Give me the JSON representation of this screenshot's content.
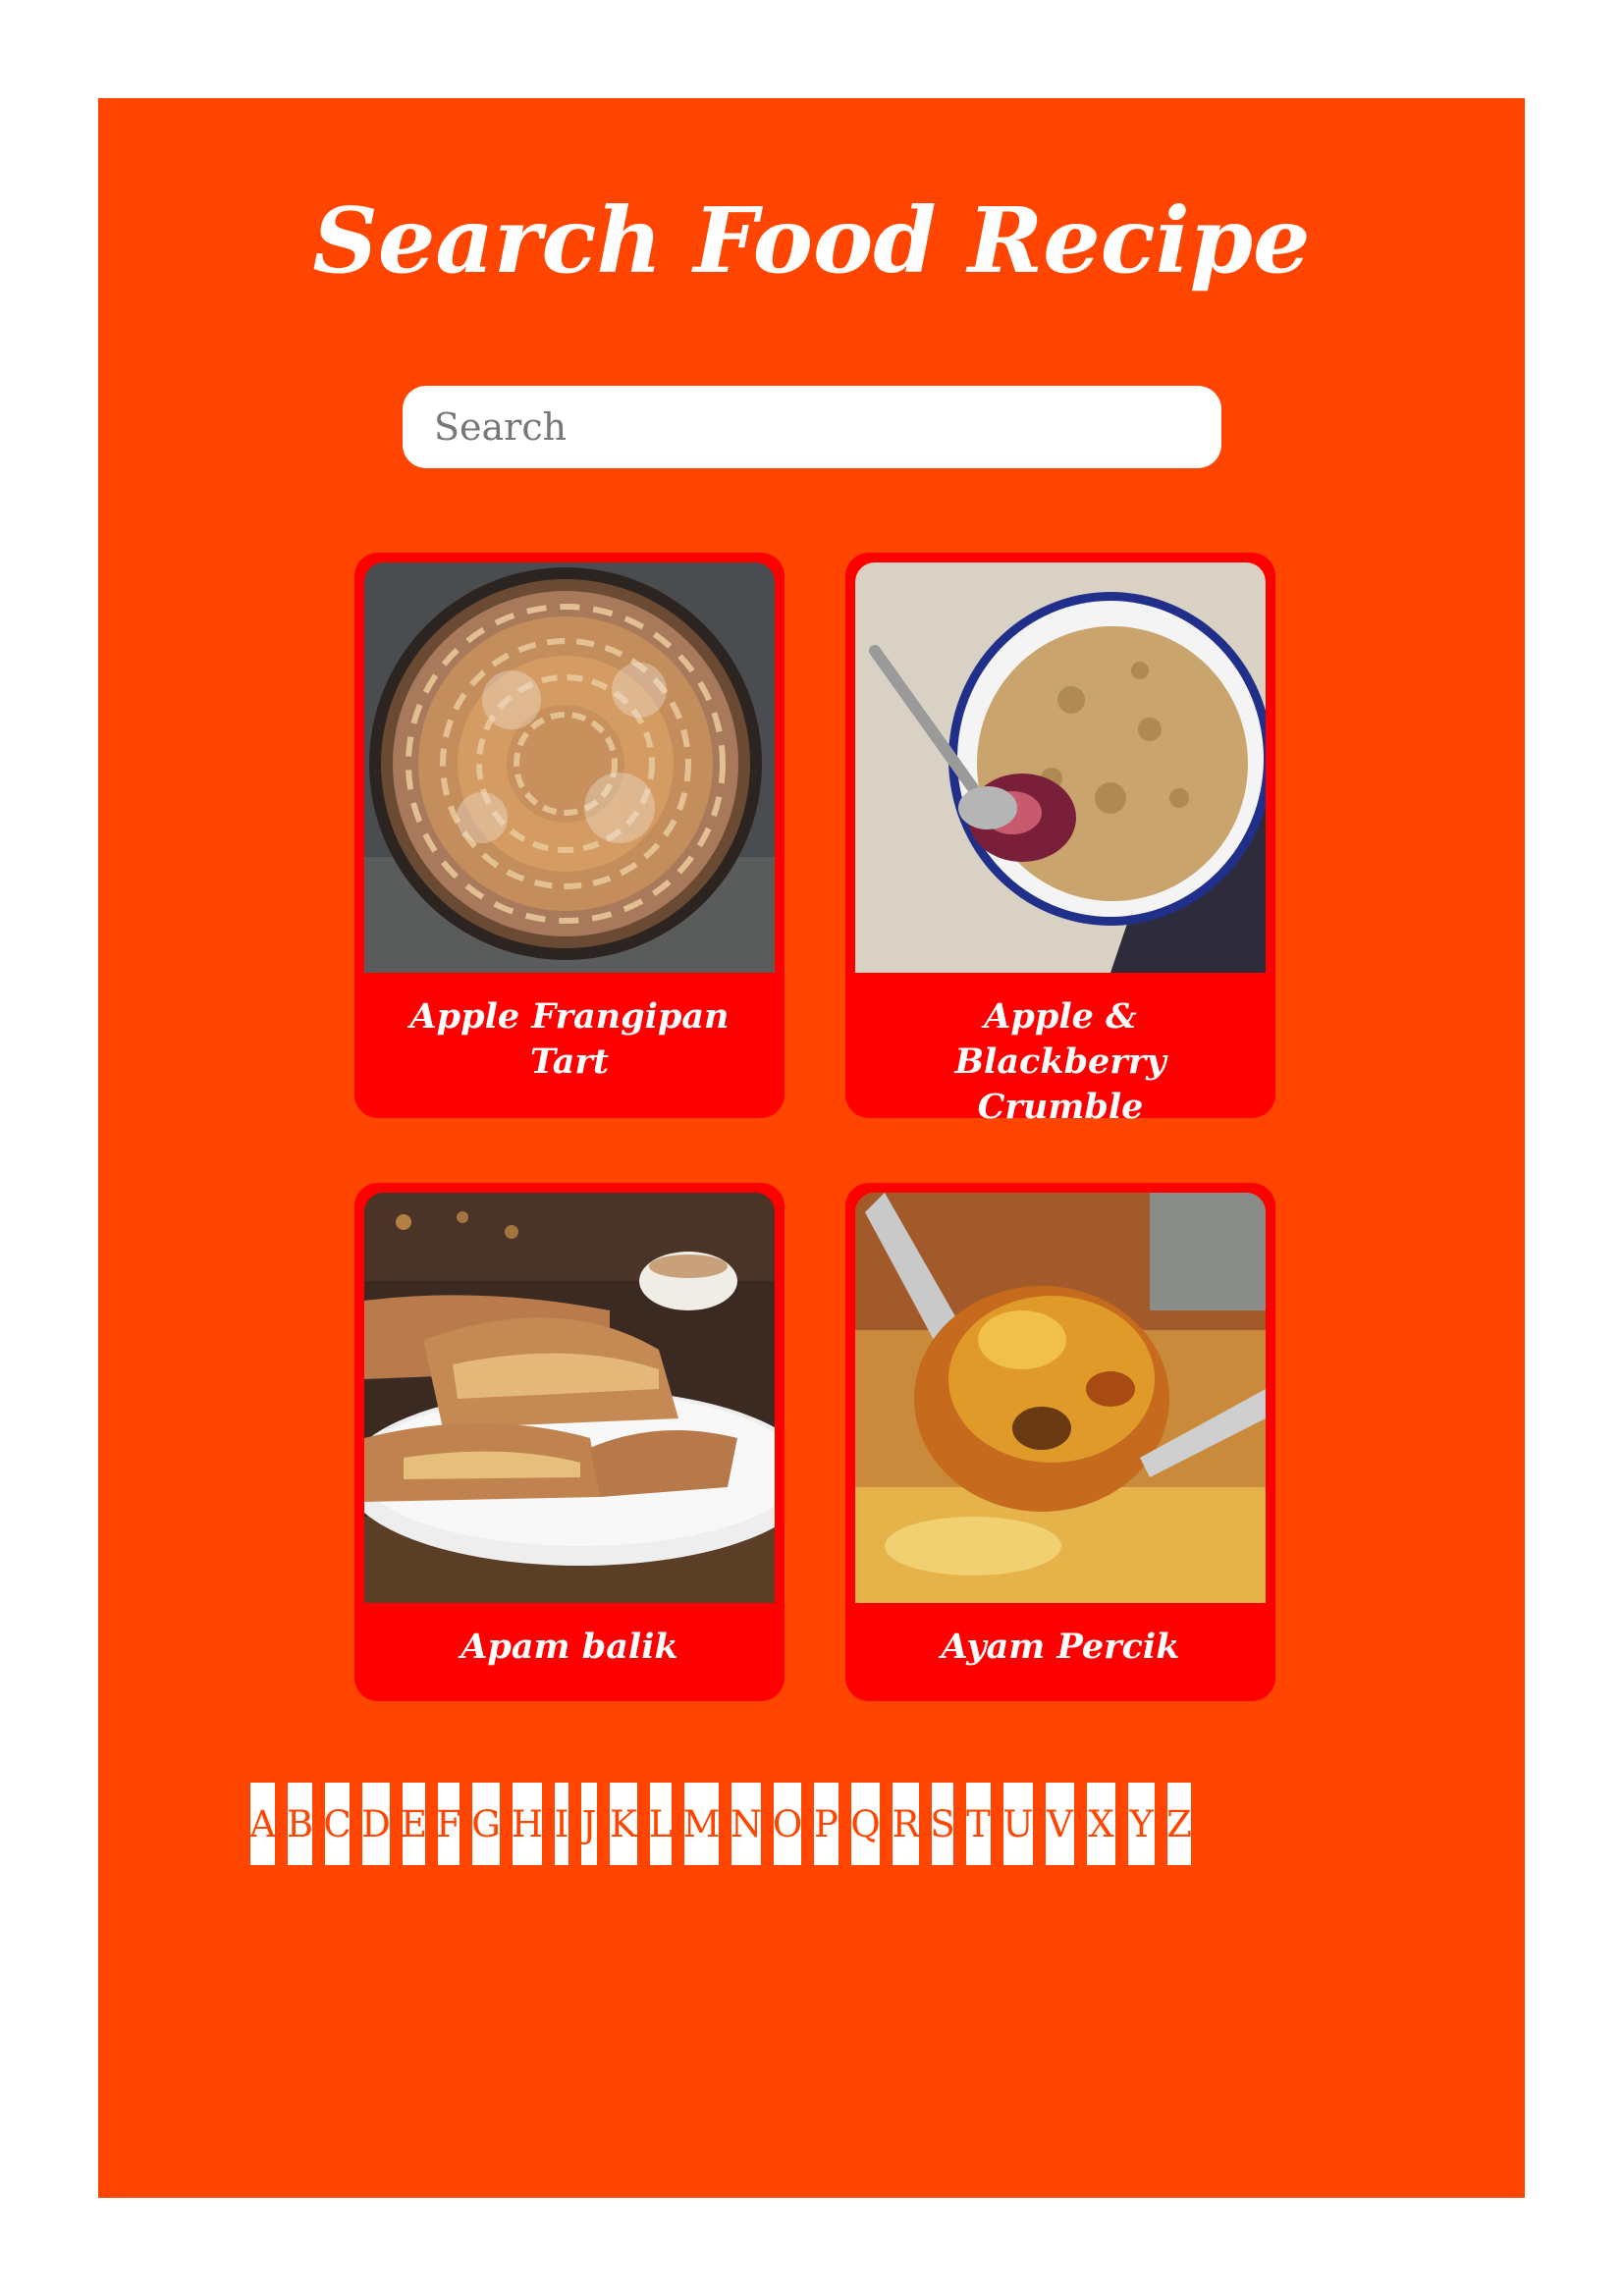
{
  "page": {
    "title": "Search Food Recipe",
    "search_placeholder": "Search"
  },
  "recipes": [
    {
      "name": "Apple Frangipan Tart"
    },
    {
      "name": "Apple & Blackberry Crumble"
    },
    {
      "name": "Apam balik"
    },
    {
      "name": "Ayam Percik"
    }
  ],
  "alphabet": [
    "A",
    "B",
    "C",
    "D",
    "E",
    "F",
    "G",
    "H",
    "I",
    "J",
    "K",
    "L",
    "M",
    "N",
    "O",
    "P",
    "Q",
    "R",
    "S",
    "T",
    "U",
    "V",
    "X",
    "Y",
    "Z"
  ],
  "colors": {
    "background": "#FF4500",
    "card": "#FF0000",
    "text": "#FFFFFF"
  }
}
